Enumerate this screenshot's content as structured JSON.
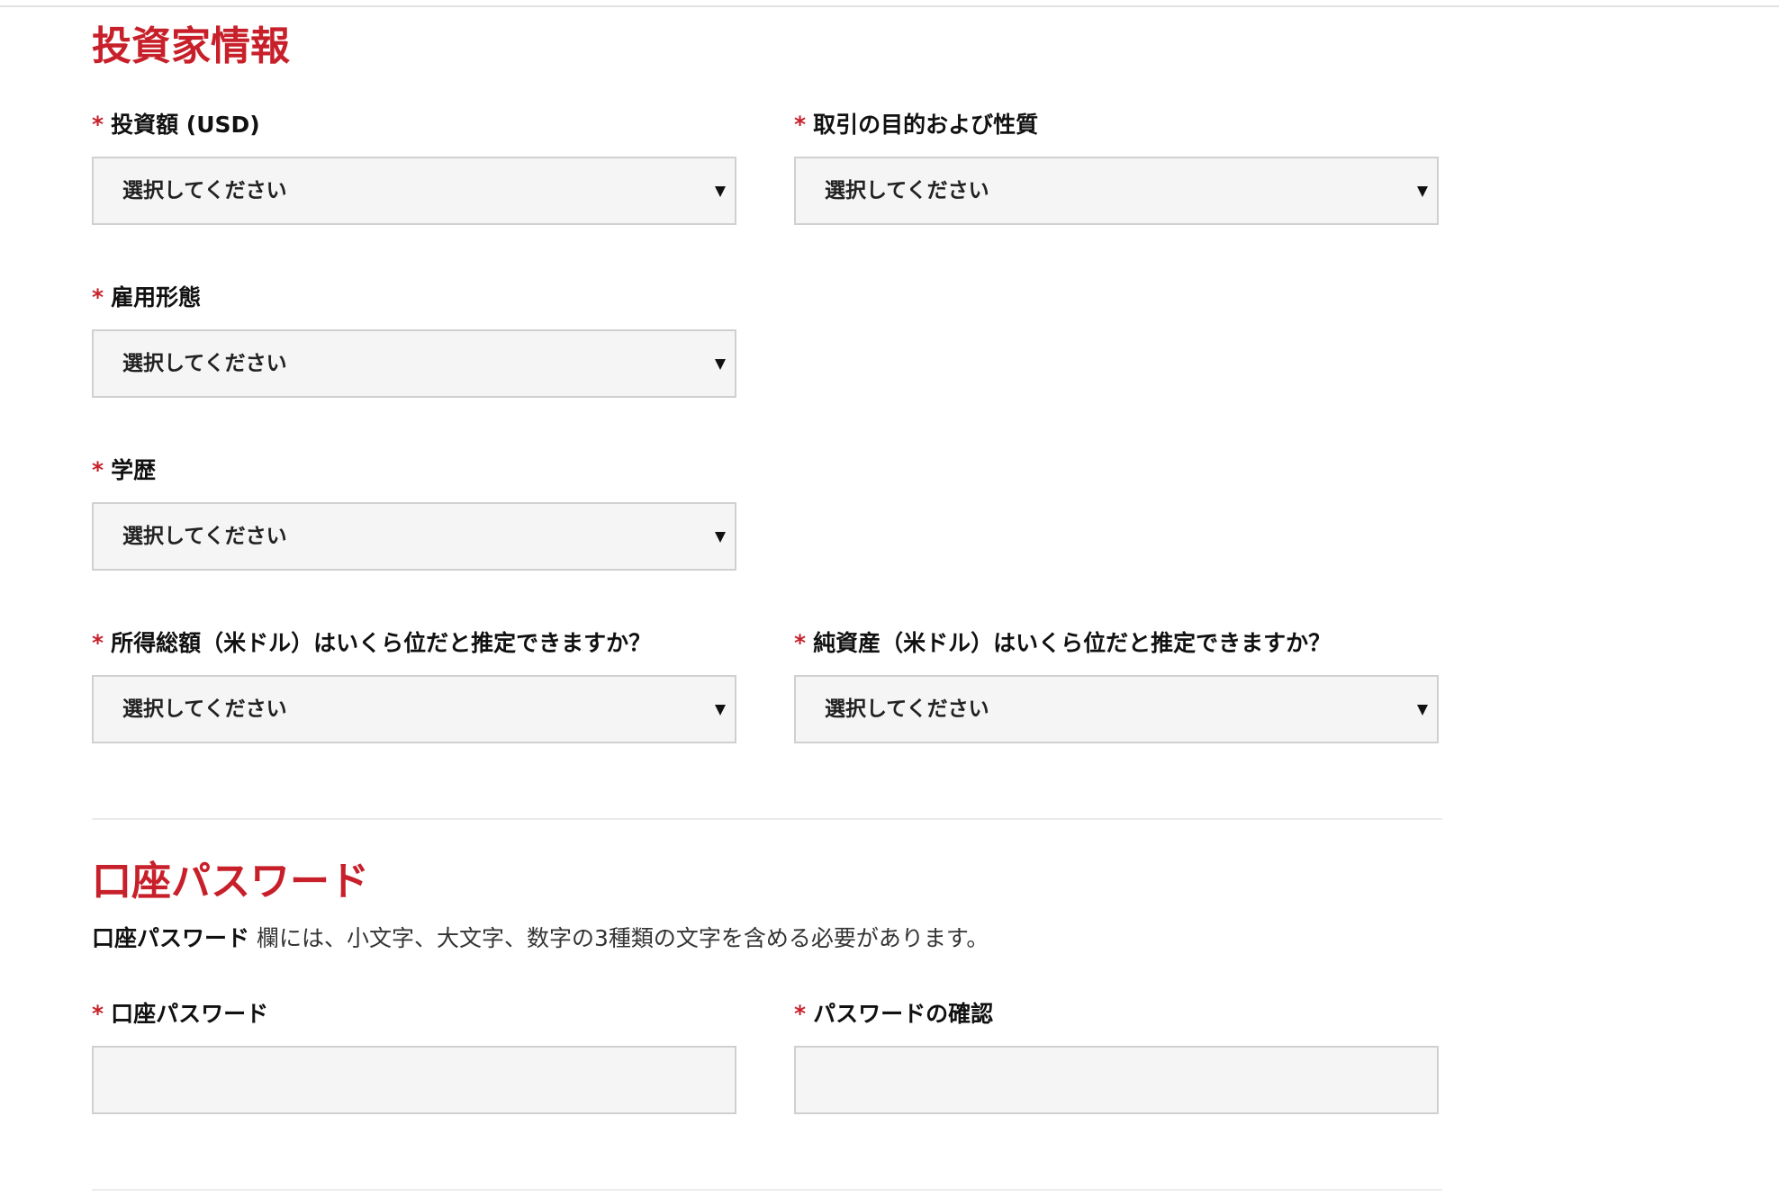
{
  "investor_section": {
    "title": "投資家情報",
    "required_mark": "*",
    "fields": {
      "investment_amount": {
        "label": "投資額 (USD)",
        "value": "選択してください"
      },
      "trading_purpose": {
        "label": "取引の目的および性質",
        "value": "選択してください"
      },
      "employment_status": {
        "label": "雇用形態",
        "value": "選択してください"
      },
      "education": {
        "label": "学歴",
        "value": "選択してください"
      },
      "annual_income": {
        "label": "所得総額（米ドル）はいくら位だと推定できますか？",
        "value": "選択してください"
      },
      "net_worth": {
        "label": "純資産（米ドル）はいくら位だと推定できますか？",
        "value": "選択してください"
      }
    }
  },
  "password_section": {
    "title": "口座パスワード",
    "note_bold": "口座パスワード",
    "note_text": " 欄には、小文字、大文字、数字の3種類の文字を含める必要があります。",
    "fields": {
      "password": {
        "label": "口座パスワード",
        "value": ""
      },
      "password_confirm": {
        "label": "パスワードの確認",
        "value": ""
      }
    }
  },
  "colors": {
    "accent": "#c8202a",
    "input_background": "#f5f5f5",
    "input_border": "#d0d0d0"
  }
}
